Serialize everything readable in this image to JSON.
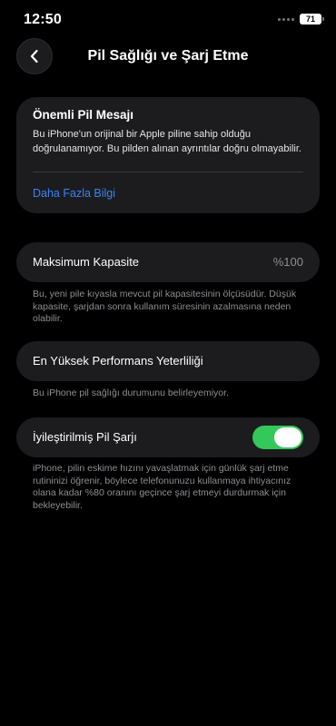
{
  "status": {
    "time": "12:50",
    "battery": "71"
  },
  "nav": {
    "title": "Pil Sağlığı ve Şarj Etme"
  },
  "message": {
    "title": "Önemli Pil Mesajı",
    "body": "Bu iPhone'un orijinal bir Apple piline sahip olduğu doğrulanamıyor. Bu pilden alınan ayrıntılar doğru olmayabilir.",
    "link": "Daha Fazla Bilgi",
    "link_color": "#3b82f6"
  },
  "capacity": {
    "label": "Maksimum Kapasite",
    "value": "%100",
    "footnote": "Bu, yeni pile kıyasla mevcut pil kapasitesinin ölçüsüdür. Düşük kapasite, şarjdan sonra kullanım süresinin azalmasına neden olabilir."
  },
  "performance": {
    "label": "En Yüksek Performans Yeterliliği",
    "footnote": "Bu iPhone pil sağlığı durumunu belirleyemiyor."
  },
  "optimized": {
    "label": "İyileştirilmiş Pil Şarjı",
    "enabled": true,
    "toggle_color": "#34c759",
    "footnote": "iPhone, pilin eskime hızını yavaşlatmak için günlük şarj etme rutininizi öğrenir, böylece telefonunuzu kullanmaya ihtiyacınız olana kadar %80 oranını geçince şarj etmeyi durdurmak için bekleyebilir."
  },
  "icons": {
    "back": "chevron-left-icon",
    "signal": "signal-dots-icon",
    "battery": "battery-icon"
  }
}
